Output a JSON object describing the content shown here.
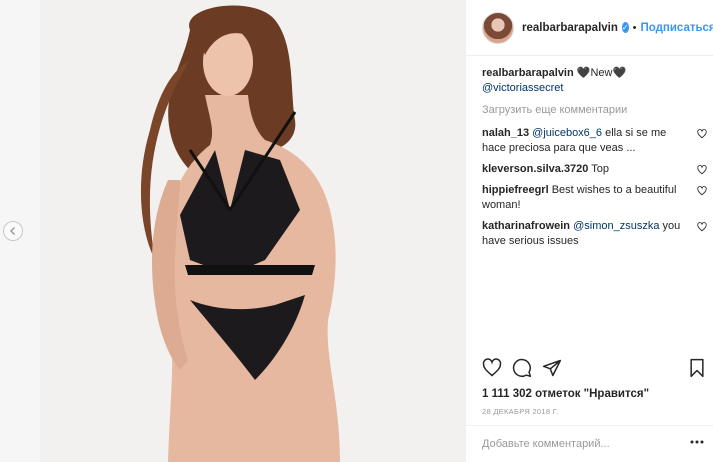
{
  "header": {
    "username": "realbarbarapalvin",
    "separator": "•",
    "follow_label": "Подписаться"
  },
  "caption": {
    "username": "realbarbarapalvin",
    "text": "🖤New🖤",
    "mention": "@victoriassecret"
  },
  "load_more": "Загрузить еще комментарии",
  "comments": [
    {
      "username": "nalah_13",
      "mention": "@juicebox6_6",
      "text": " ella si se me hace preciosa para que veas ..."
    },
    {
      "username": "kleverson.silva.3720",
      "mention": "",
      "text": "Top"
    },
    {
      "username": "hippiefreegrl",
      "mention": "",
      "text": "Best wishes to a beautiful woman!"
    },
    {
      "username": "katharinafrowein",
      "mention": "@simon_zsuszka",
      "text": " you have serious issues"
    }
  ],
  "likes": "1 111 302 отметок \"Нравится\"",
  "date": "28 ДЕКАБРЯ 2018 Г.",
  "add_comment_placeholder": "Добавьте комментарий...",
  "icons": {
    "like": "heart-outline-icon",
    "comment": "speech-bubble-icon",
    "share": "paper-plane-icon",
    "save": "bookmark-icon",
    "prev": "chevron-left-icon",
    "more": "more-dots-icon"
  },
  "colors": {
    "link_blue": "#3897f0",
    "mention": "#003569",
    "muted": "#999999",
    "border": "#efefef"
  }
}
